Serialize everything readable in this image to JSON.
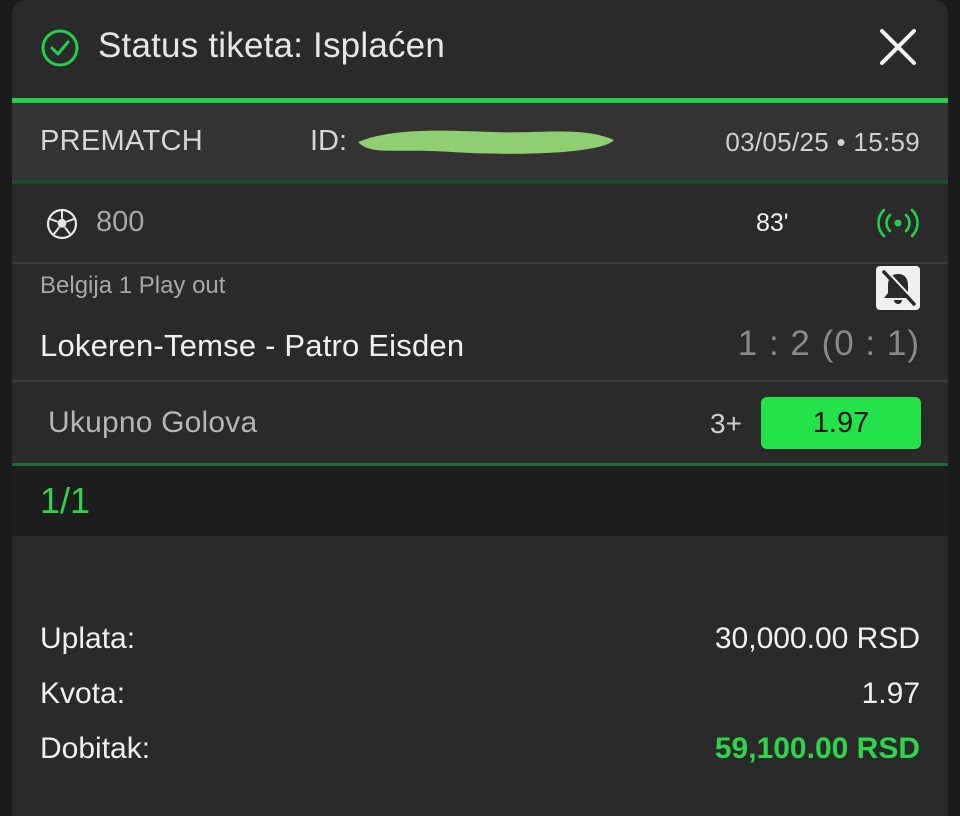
{
  "header": {
    "title": "Status tiketa: Isplaćen",
    "status_icon": "check-circle-icon",
    "close_icon": "close-icon"
  },
  "ticket": {
    "type": "PREMATCH",
    "id_label": "ID:",
    "date_time": "03/05/25 • 15:59"
  },
  "event": {
    "sport_icon": "soccer-ball-icon",
    "code": "800",
    "minute": "83'",
    "live_icon": "live-broadcast-icon",
    "league": "Belgija 1 Play out",
    "notification_icon": "bell-off-icon",
    "match": "Lokeren-Temse - Patro Eisden",
    "score": "1 : 2 (0 : 1)",
    "market": "Ukupno Golova",
    "pick": "3+",
    "odds": "1.97"
  },
  "count": "1/1",
  "summary": {
    "stake_label": "Uplata:",
    "stake_value": "30,000.00 RSD",
    "odds_label": "Kvota:",
    "odds_value": "1.97",
    "win_label": "Dobitak:",
    "win_value": "59,100.00 RSD"
  },
  "colors": {
    "accent_green": "#24e24a",
    "background": "#2a2a2a",
    "redaction_green": "#8fcf72"
  }
}
